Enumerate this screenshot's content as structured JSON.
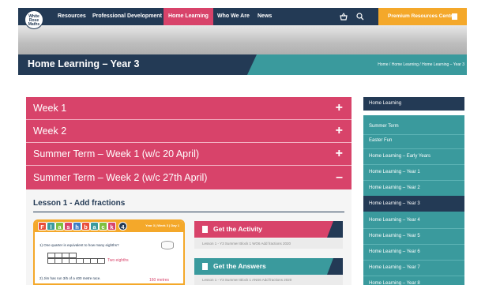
{
  "nav": {
    "logo": [
      "White",
      "Rose",
      "Maths"
    ],
    "items": [
      "Resources",
      "Professional Development",
      "Home Learning",
      "Who We Are",
      "News"
    ],
    "active_index": 2,
    "premium_label": "Premium Resources Centre"
  },
  "header": {
    "title": "Home Learning – Year 3",
    "breadcrumb": "Home / Home Learning / Home Learning – Year 3"
  },
  "accordion": [
    {
      "label": "Week 1",
      "sign": "+"
    },
    {
      "label": "Week 2",
      "sign": "+"
    },
    {
      "label": "Summer Term – Week 1 (w/c 20 April)",
      "sign": "+"
    },
    {
      "label": "Summer Term – Week 2 (w/c 27th April)",
      "sign": "–"
    }
  ],
  "lesson": {
    "title": "Lesson 1 - Add fractions",
    "flashback": {
      "letters": [
        "F",
        "l",
        "a",
        "s",
        "h",
        "b",
        "a",
        "c",
        "k",
        "4"
      ],
      "meta": "Year 3 | Week 3 | Day 1",
      "q1": "1)  One quarter is equivalent to how many eighths?",
      "q1_answer": "Two eighths",
      "q2": "2)  Jim has run 3/5 of a 400 metre race.",
      "q2_answer": "160 metres"
    },
    "activity": {
      "label": "Get the Activity",
      "file": "Lesson 1 - Y3 Summer Block 1 WO6 Add fractions 2020"
    },
    "answers": {
      "label": "Get the Answers",
      "file": "Lesson 1 - Y3 Summer Block 1 ANS6 Add fractions 2020"
    }
  },
  "sidebar": {
    "header": "Home Learning",
    "items": [
      "Summer Term",
      "Easter Fun",
      "Home Learning – Early Years",
      "Home Learning – Year 1",
      "Home Learning – Year 2",
      "Home Learning – Year 3",
      "Home Learning – Year 4",
      "Home Learning – Year 5",
      "Home Learning – Year 6",
      "Home Learning – Year 7",
      "Home Learning – Year 8"
    ],
    "active_index": 5
  },
  "colors": {
    "navy": "#233a55",
    "pink": "#d8436a",
    "teal": "#3a9a9d",
    "orange": "#f4a82a"
  }
}
